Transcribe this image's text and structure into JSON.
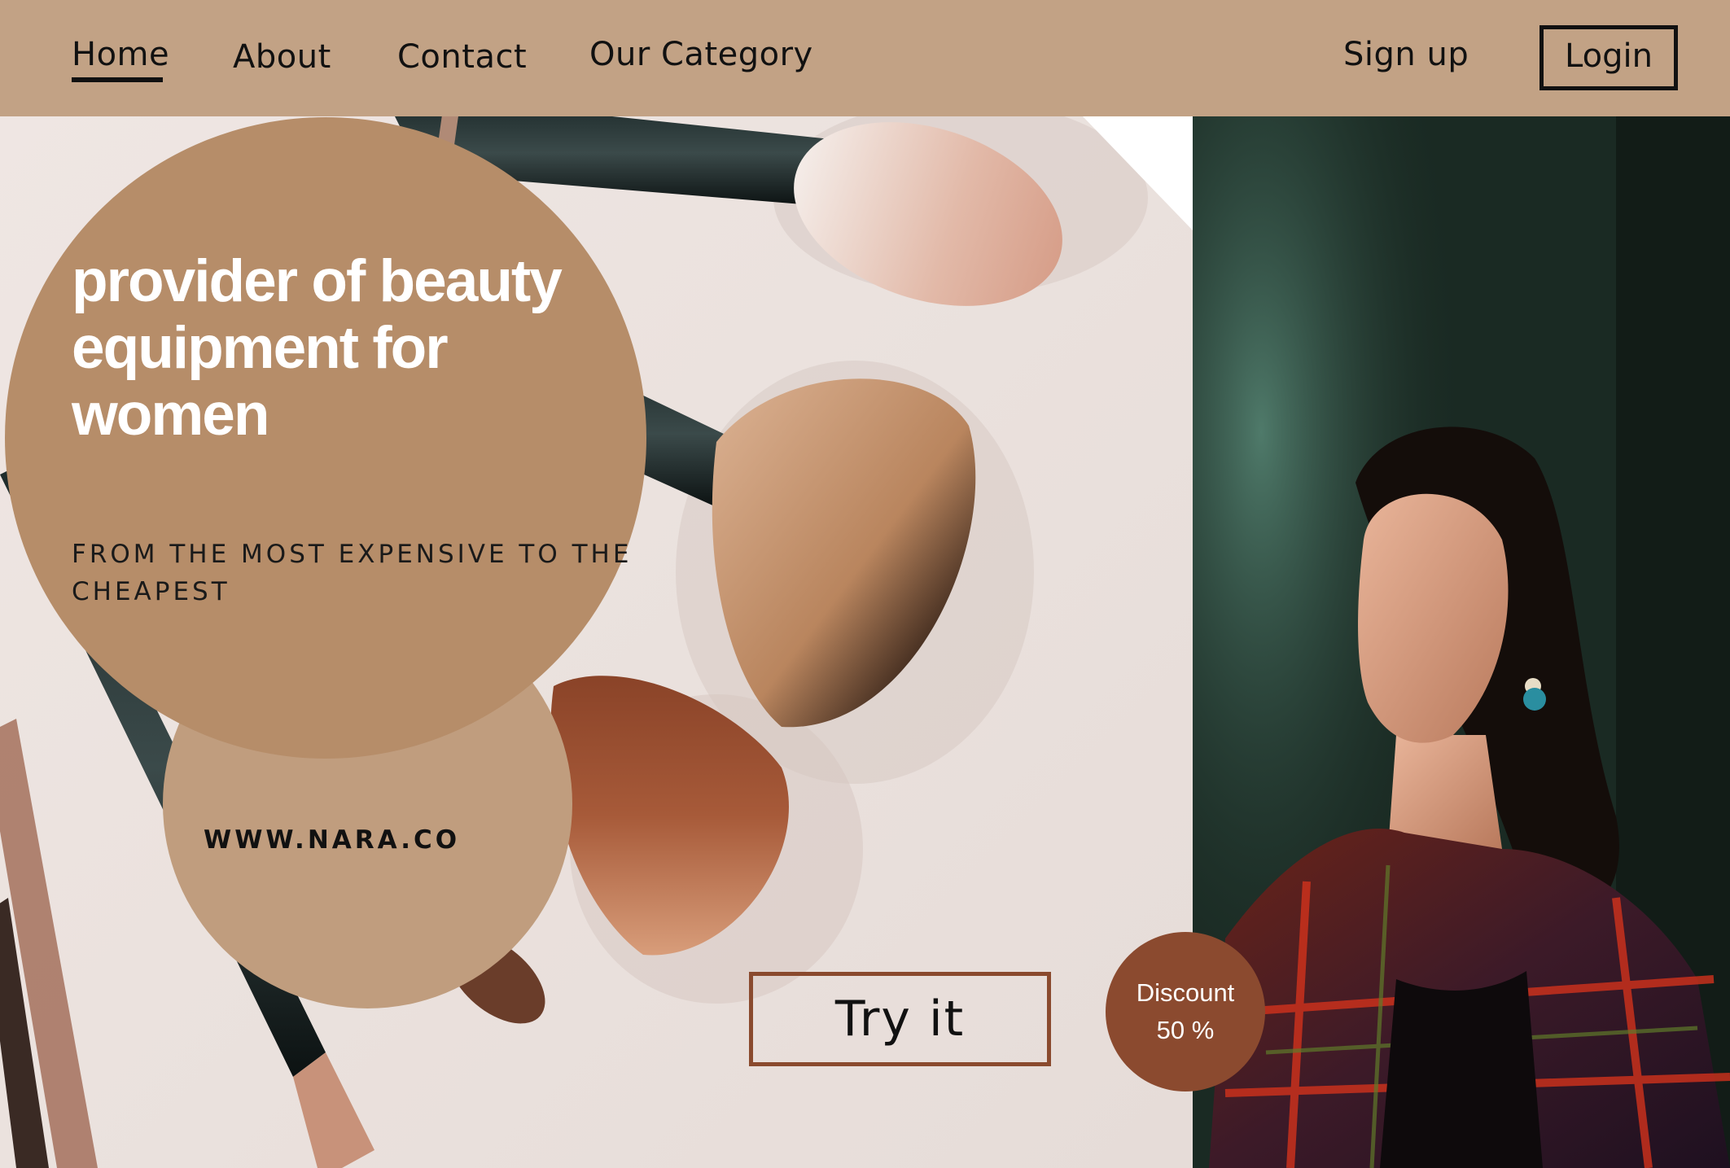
{
  "nav": {
    "home": "Home",
    "about": "About",
    "contact": "Contact",
    "category": "Our Category",
    "signup": "Sign up",
    "login": "Login"
  },
  "hero": {
    "headline": "provider of beauty equipment for women",
    "subheadline": "FROM THE MOST EXPENSIVE TO THE CHEAPEST",
    "website": "WWW.NARA.CO",
    "cta": "Try it"
  },
  "discount": {
    "label": "Discount",
    "value": "50 %"
  },
  "colors": {
    "topbar": "#c2a285",
    "circle_big": "#b68d69",
    "circle_small": "#c09d7e",
    "accent": "#8b4a2f"
  }
}
